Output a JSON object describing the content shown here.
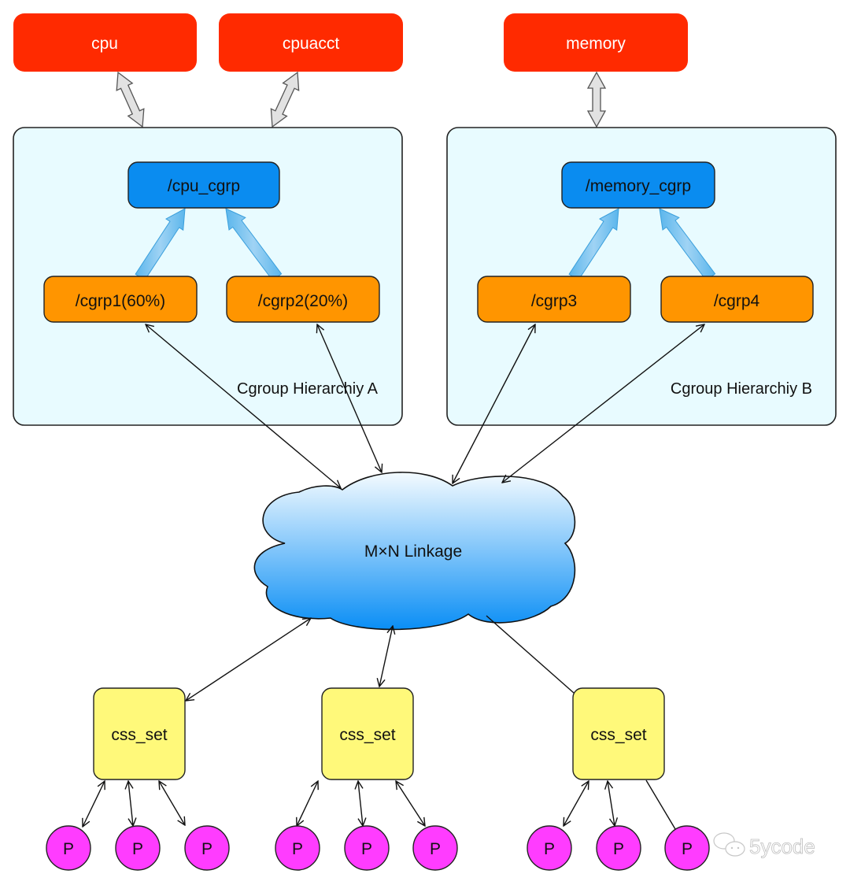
{
  "subsystems": [
    {
      "id": "cpu",
      "label": "cpu"
    },
    {
      "id": "cpuacct",
      "label": "cpuacct"
    },
    {
      "id": "memory",
      "label": "memory"
    }
  ],
  "hierarchies": [
    {
      "id": "A",
      "title": "Cgroup Hierarchiy A",
      "root": "/cpu_cgrp",
      "children": [
        "/cgrp1(60%)",
        "/cgrp2(20%)"
      ]
    },
    {
      "id": "B",
      "title": "Cgroup Hierarchiy B",
      "root": "/memory_cgrp",
      "children": [
        "/cgrp3",
        "/cgrp4"
      ]
    }
  ],
  "linkage": {
    "label": "M×N Linkage"
  },
  "css_sets": [
    {
      "label": "css_set",
      "processes": [
        "P",
        "P",
        "P"
      ]
    },
    {
      "label": "css_set",
      "processes": [
        "P",
        "P",
        "P"
      ]
    },
    {
      "label": "css_set",
      "processes": [
        "P",
        "P",
        "P"
      ]
    }
  ],
  "watermark": {
    "text": "5ycode"
  },
  "colors": {
    "subsystem": "#ff2a00",
    "hierarchy_bg": "#e8fbff",
    "root_cgroup": "#0a8cf0",
    "child_cgroup": "#ff9500",
    "css_set": "#fff97a",
    "process": "#ff3cff",
    "cloud_top": "#f2faff",
    "cloud_bottom": "#0a8ff5"
  }
}
